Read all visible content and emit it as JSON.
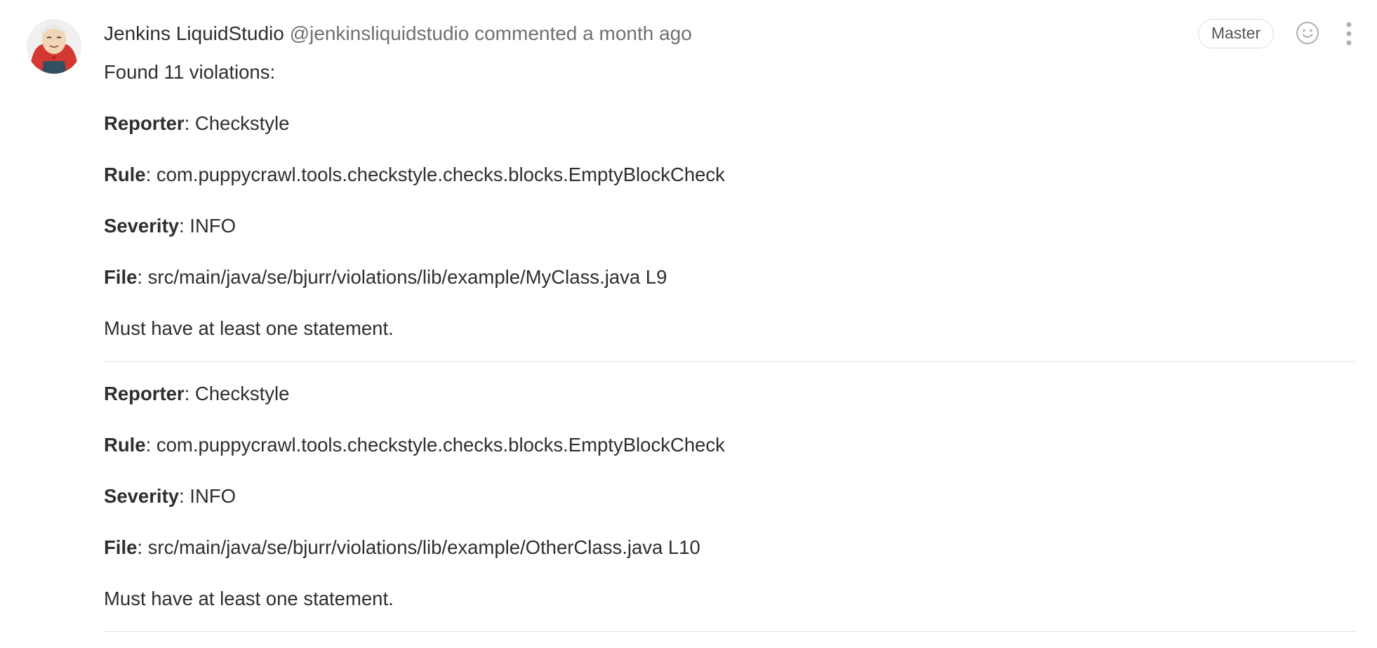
{
  "comment": {
    "author_name": "Jenkins LiquidStudio",
    "author_handle": "@jenkinsliquidstudio",
    "meta": "commented a month ago",
    "role_badge": "Master",
    "icons": {
      "avatar": "jenkins-avatar",
      "reaction": "smiley-face-icon",
      "more": "vertical-ellipsis-icon"
    },
    "intro": "Found 11 violations:",
    "labels": {
      "reporter": "Reporter",
      "rule": "Rule",
      "severity": "Severity",
      "file": "File"
    },
    "violations": [
      {
        "reporter": ": Checkstyle",
        "rule": ": com.puppycrawl.tools.checkstyle.checks.blocks.EmptyBlockCheck",
        "severity": ": INFO",
        "file": ": src/main/java/se/bjurr/violations/lib/example/MyClass.java L9",
        "message": "Must have at least one statement."
      },
      {
        "reporter": ": Checkstyle",
        "rule": ": com.puppycrawl.tools.checkstyle.checks.blocks.EmptyBlockCheck",
        "severity": ": INFO",
        "file": ": src/main/java/se/bjurr/violations/lib/example/OtherClass.java L10",
        "message": "Must have at least one statement."
      }
    ]
  },
  "colors": {
    "text": "#2e2e2e",
    "muted": "#707070",
    "divider": "#e1e1e1",
    "badge_border": "#dcdcdc"
  }
}
